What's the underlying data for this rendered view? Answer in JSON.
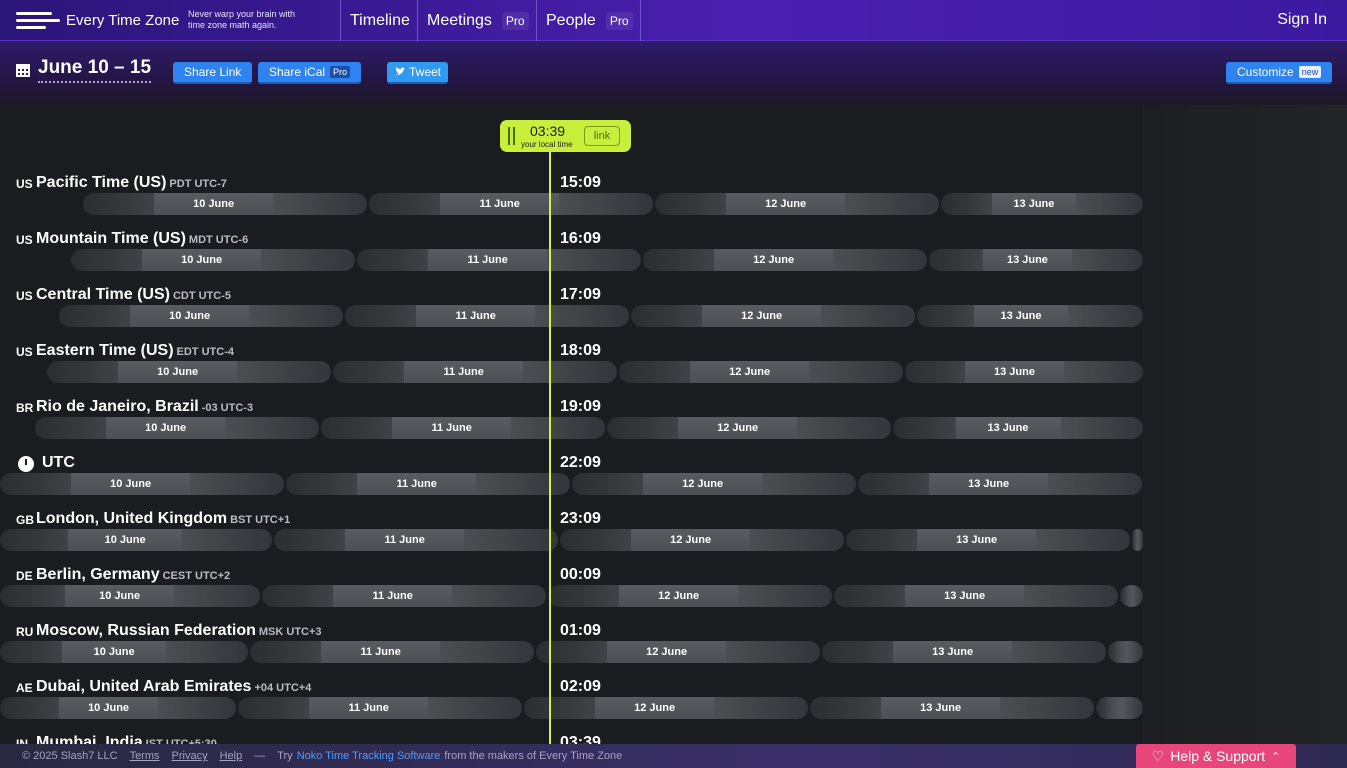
{
  "brand": {
    "name": "Every Time Zone",
    "tagline_1": "Never warp your brain with",
    "tagline_2": "time zone math again."
  },
  "nav": {
    "timeline": "Timeline",
    "meetings": "Meetings",
    "meetings_tag": "Pro",
    "people": "People",
    "people_tag": "Pro",
    "sign_in": "Sign In"
  },
  "header": {
    "date_range": "June 10 – 15",
    "share_link": "Share Link",
    "share_ical": "Share iCal",
    "share_ical_tag": "Pro",
    "tweet": "Tweet",
    "customize": "Customize",
    "customize_tag": "new"
  },
  "now": {
    "time": "03:39",
    "label": "your local time",
    "link": "link",
    "accent": "#c8f03a"
  },
  "zones": [
    {
      "cc": "US",
      "name": "Pacific Time (US)",
      "abbr": "PDT UTC-7",
      "time": "15:09",
      "days": [
        "10 June",
        "11 June",
        "12 June",
        "13 June"
      ]
    },
    {
      "cc": "US",
      "name": "Mountain Time (US)",
      "abbr": "MDT UTC-6",
      "time": "16:09",
      "days": [
        "10 June",
        "11 June",
        "12 June",
        "13 June"
      ]
    },
    {
      "cc": "US",
      "name": "Central Time (US)",
      "abbr": "CDT UTC-5",
      "time": "17:09",
      "days": [
        "10 June",
        "11 June",
        "12 June",
        "13 June"
      ]
    },
    {
      "cc": "US",
      "name": "Eastern Time (US)",
      "abbr": "EDT UTC-4",
      "time": "18:09",
      "days": [
        "10 June",
        "11 June",
        "12 June",
        "13 June"
      ]
    },
    {
      "cc": "BR",
      "name": "Rio de Janeiro, Brazil",
      "abbr": "-03 UTC-3",
      "time": "19:09",
      "days": [
        "10 June",
        "11 June",
        "12 June",
        "13 June"
      ]
    },
    {
      "cc": "",
      "name": "UTC",
      "abbr": "",
      "time": "22:09",
      "days": [
        "10 June",
        "11 June",
        "12 June",
        "13 June"
      ],
      "icon": "clock-icon"
    },
    {
      "cc": "GB",
      "name": "London, United Kingdom",
      "abbr": "BST UTC+1",
      "time": "23:09",
      "days": [
        "10 June",
        "11 June",
        "12 June",
        "13 June"
      ]
    },
    {
      "cc": "DE",
      "name": "Berlin, Germany",
      "abbr": "CEST UTC+2",
      "time": "00:09",
      "days": [
        "10 June",
        "11 June",
        "12 June",
        "13 June"
      ]
    },
    {
      "cc": "RU",
      "name": "Moscow, Russian Federation",
      "abbr": "MSK UTC+3",
      "time": "01:09",
      "days": [
        "10 June",
        "11 June",
        "12 June",
        "13 June"
      ]
    },
    {
      "cc": "AE",
      "name": "Dubai, United Arab Emirates",
      "abbr": "+04 UTC+4",
      "time": "02:09",
      "days": [
        "10 June",
        "11 June",
        "12 June",
        "13 June"
      ]
    },
    {
      "cc": "IN",
      "name": "Mumbai, India",
      "abbr": "IST UTC+5:30",
      "time": "03:39",
      "days": []
    }
  ],
  "footer": {
    "copyright": "© 2025 Slash7 LLC",
    "terms": "Terms",
    "privacy": "Privacy",
    "help": "Help",
    "dash": "—",
    "try": "Try",
    "noko": "Noko Time Tracking Software",
    "from": "from the makers of Every Time Zone",
    "support": "Help & Support"
  }
}
